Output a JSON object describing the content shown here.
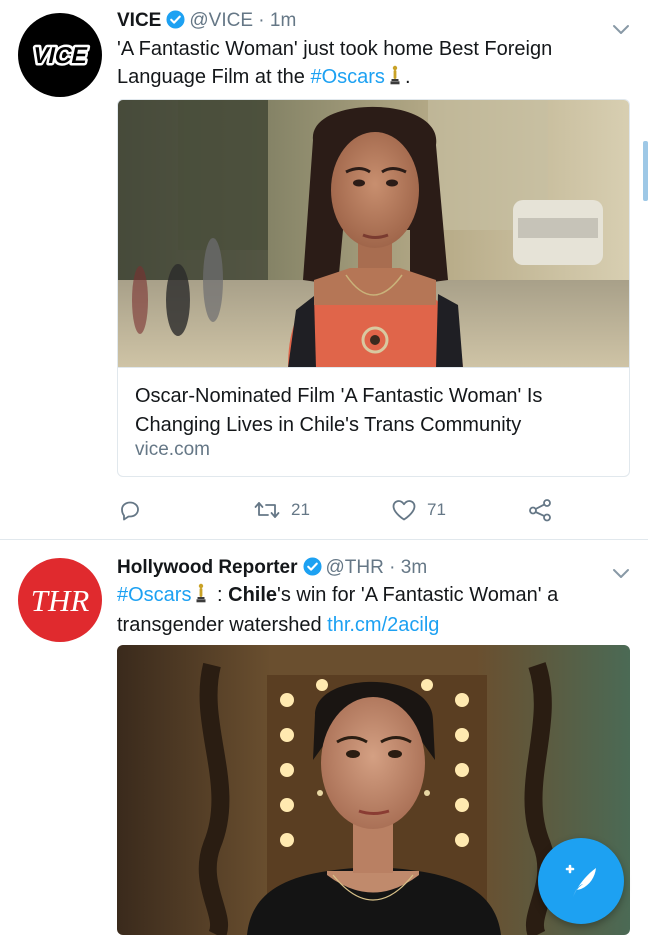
{
  "tweets": [
    {
      "author_name": "VICE",
      "handle": "@VICE",
      "separator": "·",
      "time": "1m",
      "avatar_text": "VICE",
      "text": {
        "line1": "'A Fantastic Woman' just took home Best Foreign",
        "line2_prefix": "Language Film at the ",
        "hashtag": "#Oscars",
        "line2_suffix": "."
      },
      "card": {
        "title": "Oscar-Nominated Film 'A Fantastic Woman' Is Changing Lives in Chile's Trans Community",
        "domain": "vice.com"
      },
      "actions": {
        "retweets": "21",
        "likes": "71"
      }
    },
    {
      "author_name": "Hollywood Reporter",
      "handle": "@THR",
      "separator": "·",
      "time": "3m",
      "avatar_text": "THR",
      "text": {
        "hashtag": "#Oscars",
        "colon": " : ",
        "bold": "Chile",
        "line1_suffix": "'s win for 'A Fantastic Woman' a",
        "line2_prefix": "transgender watershed ",
        "link": "thr.cm/2acilg"
      }
    }
  ],
  "colors": {
    "accent": "#1da1f2",
    "secondary_text": "#657786",
    "thr_red": "#e02a2e",
    "border": "#e1e8ed"
  },
  "icons": {
    "reply": "reply-icon",
    "retweet": "retweet-icon",
    "like": "heart-icon",
    "share": "share-icon",
    "verified": "verified-badge-icon",
    "menu": "chevron-down-icon",
    "compose": "compose-tweet-icon",
    "trophy": "oscar-trophy-emoji"
  }
}
